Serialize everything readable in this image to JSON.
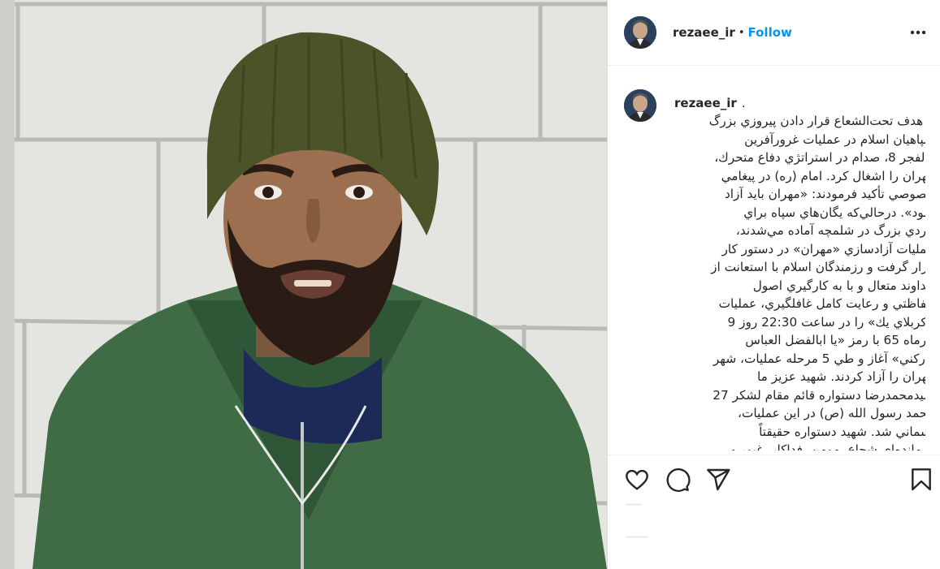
{
  "post": {
    "username": "rezaee_ir",
    "separator": "•",
    "follow_label": "Follow",
    "more_icon": "more-horizontal-icon"
  },
  "caption": {
    "username": "rezaee_ir",
    "suffix": ".",
    "text": "با هدف تحت‌الشعاع قرار دادن پيروزي بزرگ\nسپاهيان اسلام در عمليات غرورآفرين\nوالفجر 8، صدام در استراتژي دفاع متحرك،\nمهران را اشغال كرد. امام (ره) در پيغامي\nخصوصي تأكيد فرمودند: «مهران بايد آزاد\nشود». درحالي‌كه يگان‌هاي سپاه براي\nنبردي بزرگ در شلمچه آماده مي‌شدند،\nعمليات آزادسازي «مهران» در دستور كار\nقرار گرفت و رزمندگان اسلام با استعانت از\nخداوند متعال و با به كارگيري اصول\nحفاظتي و رعايت كامل غافلگيري، عمليات\n«كربلاي يك» را در ساعت 22:30 روز 9\nتيرماه 65 با رمز «يا ابالفضل العباس\nادركني» آغاز و طي 5 مرحله عمليات، شهر\nمهران را آزاد كردند. شهيد عزيز ما\nسيدمحمدرضا دستواره قائم مقام لشكر 27\nمحمد رسول الله (ص) در اين عمليات،\nآسماني شد. شهيد دستواره حقيقتاً\nفرمانده‌اي شجاع، مومن، فداكار، غيور و"
  },
  "actions": {
    "like": "heart-icon",
    "comment": "comment-icon",
    "share": "paper-plane-icon",
    "save": "bookmark-icon"
  },
  "colors": {
    "accent": "#0095f6",
    "text": "#262626",
    "border": "#dbdbdb"
  }
}
